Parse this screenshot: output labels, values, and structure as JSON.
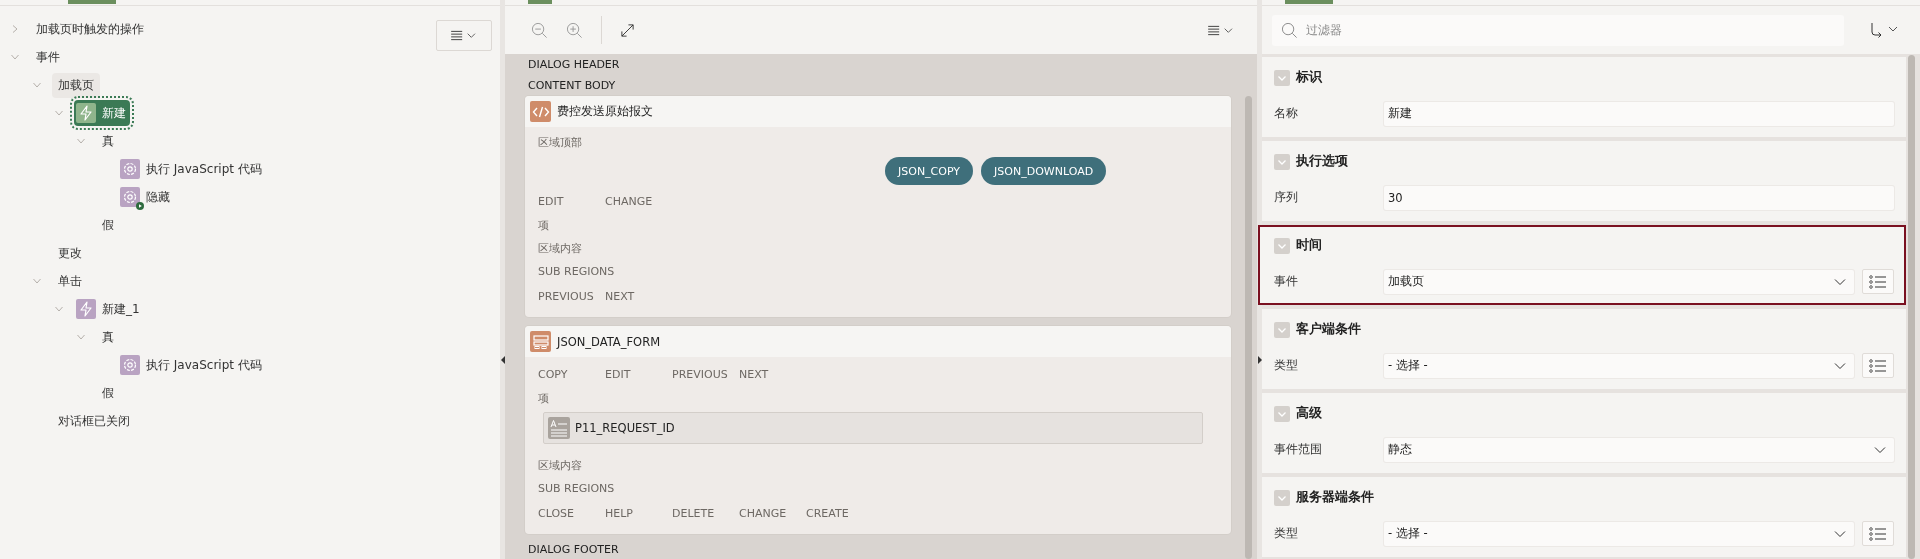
{
  "tree": {
    "nodes": [
      {
        "label": "加载页时触发的操作",
        "kind": "group",
        "expanded": false,
        "selected": false,
        "highlighted": false
      },
      {
        "label": "事件",
        "kind": "group",
        "expanded": true,
        "selected": false,
        "highlighted": false,
        "children": [
          {
            "label": "加载页",
            "kind": "group",
            "expanded": true,
            "selected": false,
            "highlighted": true,
            "children": [
              {
                "label": "新建",
                "kind": "event",
                "expanded": true,
                "selected": true,
                "highlighted": false,
                "children": [
                  {
                    "label": "真",
                    "kind": "group",
                    "expanded": true,
                    "selected": false,
                    "highlighted": false,
                    "children": [
                      {
                        "label": "执行 JavaScript 代码",
                        "kind": "action",
                        "selected": false,
                        "highlighted": false,
                        "flagged": false
                      },
                      {
                        "label": "隐藏",
                        "kind": "action",
                        "selected": false,
                        "highlighted": false,
                        "flagged": true
                      }
                    ]
                  },
                  {
                    "label": "假",
                    "kind": "group",
                    "selected": false,
                    "highlighted": false
                  }
                ]
              }
            ]
          },
          {
            "label": "更改",
            "kind": "group",
            "selected": false,
            "highlighted": false
          },
          {
            "label": "单击",
            "kind": "group",
            "expanded": true,
            "selected": false,
            "highlighted": false,
            "children": [
              {
                "label": "新建_1",
                "kind": "event",
                "expanded": true,
                "selected": false,
                "highlighted": false,
                "children": [
                  {
                    "label": "真",
                    "kind": "group",
                    "expanded": true,
                    "selected": false,
                    "highlighted": false,
                    "children": [
                      {
                        "label": "执行 JavaScript 代码",
                        "kind": "action",
                        "selected": false,
                        "highlighted": false,
                        "flagged": false
                      }
                    ]
                  },
                  {
                    "label": "假",
                    "kind": "group",
                    "selected": false,
                    "highlighted": false
                  }
                ]
              }
            ]
          },
          {
            "label": "对话框已关闭",
            "kind": "group",
            "selected": false,
            "highlighted": false
          }
        ]
      }
    ]
  },
  "layout": {
    "before": [
      "DIALOG HEADER",
      "CONTENT BODY"
    ],
    "after": [
      "DIALOG FOOTER"
    ],
    "regions": [
      {
        "title": "费控发送原始报文",
        "kind": "static",
        "slots": [
          {
            "kind": "label",
            "text": "区域顶部"
          },
          {
            "kind": "buttons",
            "items": [
              "JSON_COPY",
              "JSON_DOWNLOAD"
            ]
          },
          {
            "kind": "positions",
            "items": [
              "EDIT",
              "CHANGE"
            ]
          },
          {
            "kind": "label",
            "text": "项"
          },
          {
            "kind": "label",
            "text": "区域内容"
          },
          {
            "kind": "label",
            "text": "SUB REGIONS"
          },
          {
            "kind": "positions",
            "items": [
              "PREVIOUS",
              "NEXT"
            ]
          }
        ]
      },
      {
        "title": "JSON_DATA_FORM",
        "kind": "form",
        "slots": [
          {
            "kind": "positions",
            "items": [
              "COPY",
              "EDIT",
              "PREVIOUS",
              "NEXT"
            ]
          },
          {
            "kind": "label",
            "text": "项"
          },
          {
            "kind": "item",
            "text": "P11_REQUEST_ID"
          },
          {
            "kind": "label",
            "text": "区域内容"
          },
          {
            "kind": "label",
            "text": "SUB REGIONS"
          },
          {
            "kind": "positions",
            "items": [
              "CLOSE",
              "HELP",
              "DELETE",
              "CHANGE",
              "CREATE"
            ]
          }
        ]
      }
    ]
  },
  "properties": {
    "search": {
      "placeholder": "过滤器"
    },
    "sections": [
      {
        "title": "标识",
        "highlighted": false,
        "fields": [
          {
            "label": "名称",
            "kind": "text",
            "value": "新建",
            "list_button": false
          }
        ]
      },
      {
        "title": "执行选项",
        "highlighted": false,
        "fields": [
          {
            "label": "序列",
            "kind": "text",
            "value": "30",
            "list_button": false
          }
        ]
      },
      {
        "title": "时间",
        "highlighted": true,
        "fields": [
          {
            "label": "事件",
            "kind": "select",
            "value": "加载页",
            "list_button": true
          }
        ]
      },
      {
        "title": "客户端条件",
        "highlighted": false,
        "fields": [
          {
            "label": "类型",
            "kind": "select",
            "value": "- 选择 -",
            "list_button": true
          }
        ]
      },
      {
        "title": "高级",
        "highlighted": false,
        "fields": [
          {
            "label": "事件范围",
            "kind": "select",
            "value": "静态",
            "list_button": false
          }
        ]
      },
      {
        "title": "服务器端条件",
        "highlighted": false,
        "fields": [
          {
            "label": "类型",
            "kind": "select",
            "value": "- 选择 -",
            "list_button": true
          }
        ]
      }
    ]
  }
}
